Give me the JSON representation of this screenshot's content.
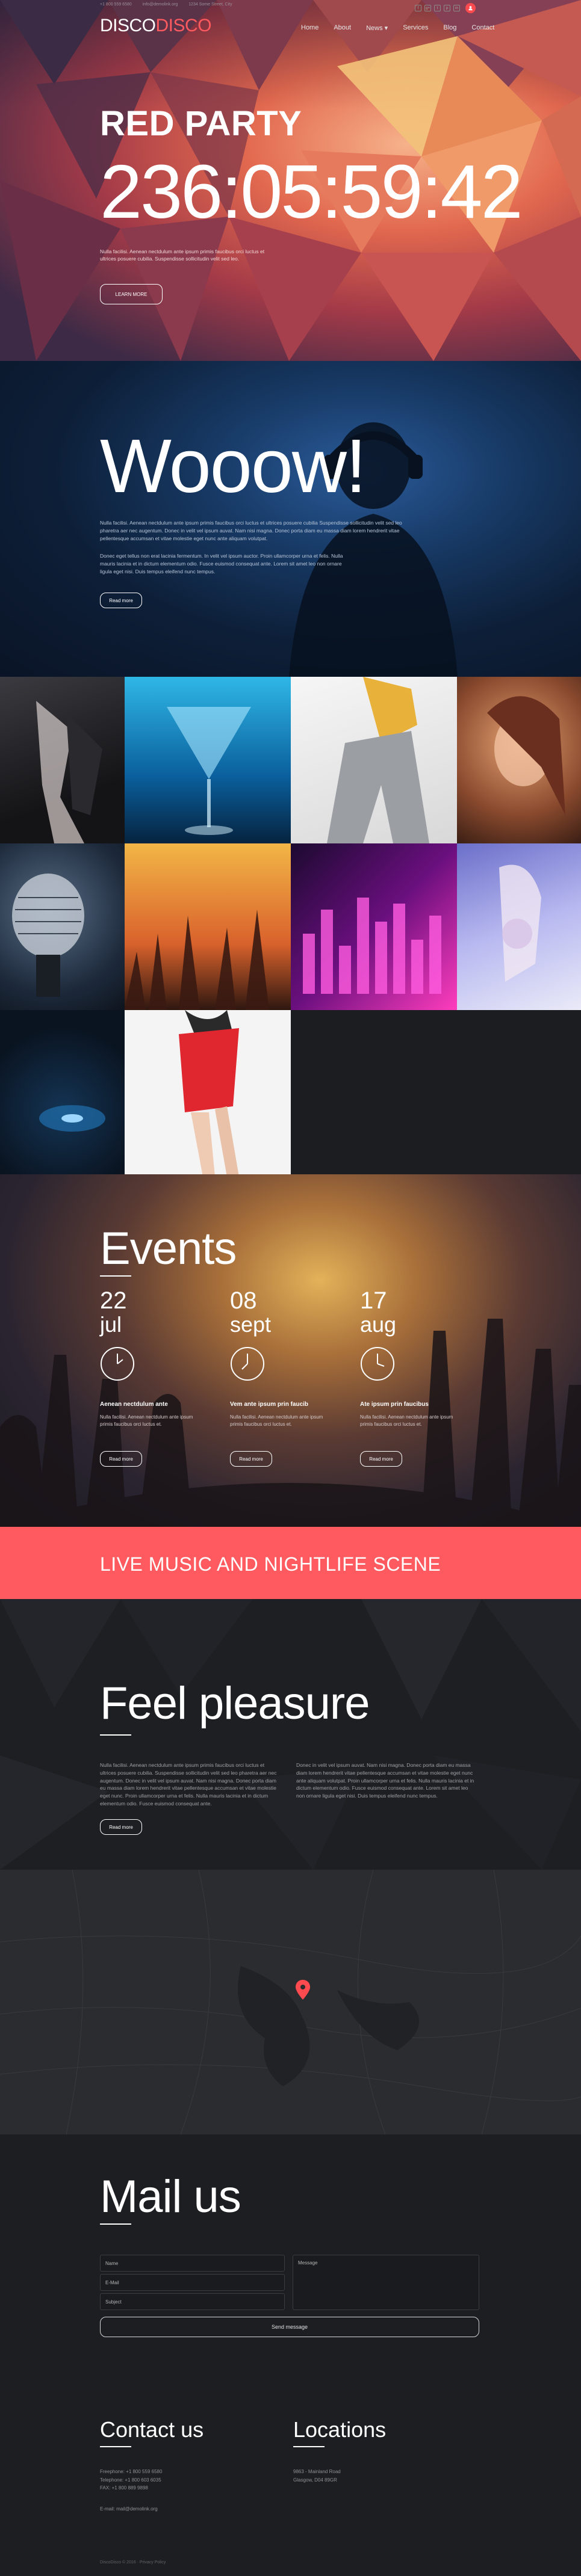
{
  "header": {
    "contacts": [
      "+1 800 559 6580",
      "info@demolink.org",
      "1234 Some Street, City"
    ],
    "logo_part1": "DISCO",
    "logo_part2": "DISCO",
    "socials": [
      "f",
      "g+",
      "t",
      "p",
      "in"
    ],
    "nav": [
      "Home",
      "About",
      "News ▾",
      "Services",
      "Blog",
      "Contact"
    ]
  },
  "hero": {
    "title": "RED PARTY",
    "countdown": "236:05:59:42",
    "text": "Nulla facilisi. Aenean nectdulum ante ipsum primis faucibus orci luctus et ultrices posuere cubilia. Suspendisse sollicitudin velit sed leo.",
    "button": "LEARN MORE"
  },
  "wooow": {
    "title": "Wooow!",
    "p1": "Nulla facilisi. Aenean nectdulum ante ipsum primis faucibus orci luctus et ultrices posuere cubilia Suspendisse sollicitudin velit sed leo pharetra aer nec augentum. Donec in velit vel ipsum auvat. Nam nisi magna. Donec porta diam eu massa diam lorem hendrerit vitae pellentesque accumsan et vitae molestie eget nunc ante aliquam volutpat.",
    "p2": "Donec eget tellus non erat lacinia fermentum. In velit vel ipsum auctor. Proin ullamcorper urna et felis. Nulla mauris lacinia et in dictum elementum odio. Fusce euismod consequat ante. Lorem sit amet leo non ornare ligula eget nisi. Duis tempus eleifend nunc tempus.",
    "button": "Read more"
  },
  "gallery": {
    "tiles": [
      "dancer-legs-photo",
      "cocktail-glass-photo",
      "dancer-jeans-photo",
      "woman-portrait-photo",
      "microphone-photo",
      "crowd-hands-photo",
      "equalizer-lights-photo",
      "singer-glitter-photo",
      "dj-deck-photo",
      "red-dress-photo"
    ]
  },
  "events": {
    "title": "Events",
    "items": [
      {
        "day": "22",
        "month": "jul",
        "name": "Aenean nectdulum ante",
        "desc": "Nulla facilisi. Aenean nectdulum ante ipsum primis faucibus orci luctus et.",
        "button": "Read more"
      },
      {
        "day": "08",
        "month": "sept",
        "name": "Vem ante ipsum prin faucib",
        "desc": "Nulla facilisi. Aenean nectdulum ante ipsum primis faucibus orci luctus et.",
        "button": "Read more"
      },
      {
        "day": "17",
        "month": "aug",
        "name": "Ate ipsum prin faucibus",
        "desc": "Nulla facilisi. Aenean nectdulum ante ipsum primis faucibus orci luctus et.",
        "button": "Read more"
      }
    ]
  },
  "banner": {
    "text": "LIVE MUSIC AND NIGHTLIFE SCENE"
  },
  "feel": {
    "title": "Feel pleasure",
    "col1": "Nulla facilisi. Aenean nectdulum ante ipsum primis faucibus orci luctus et ultrices posuere cubilia. Suspendisse sollicitudin velit sed leo pharetra aer nec augentum. Donec in velit vel ipsum auvat. Nam nisi magna. Donec porta diam eu massa diam lorem hendrerit vitae pellentesque accumsan et vitae molestie eget nunc. Proin ullamcorper urna et felis. Nulla mauris lacinia et in dictum elementum odio. Fusce euismod consequat ante.",
    "col2": "Donec in velit vel ipsum auvat. Nam nisi magna. Donec porta diam eu massa diam lorem hendrerit vitae pellentesque accumsan et vitae molestie eget nunc ante aliquam volutpat. Proin ullamcorper urna et felis. Nulla mauris lacinia et in dictum elementum odio. Fusce euismod consequat ante. Lorem sit amet leo non ornare ligula eget nisi. Duis tempus eleifend nunc tempus.",
    "button": "Read more"
  },
  "map": {
    "marker": "map-pin-icon"
  },
  "mail": {
    "title": "Mail us",
    "name_placeholder": "Name",
    "email_placeholder": "E-Mail",
    "subject_placeholder": "Subject",
    "message_placeholder": "Message",
    "send": "Send message"
  },
  "footer": {
    "contact_title": "Contact us",
    "contact_lines": [
      "Freephone: +1 800 559 6580",
      "Telephone: +1 800 603 6035",
      "FAX: +1 800 889 9898"
    ],
    "email_line": "E-mail: mail@demolink.org",
    "locations_title": "Locations",
    "address_lines": [
      "9863 - Mainland Road",
      "Glasgow, D04 89GR"
    ],
    "copyright": "DiscoDisco © 2016 · Privacy Policy"
  },
  "colors": {
    "accent": "#ff5a5f",
    "background": "#1b1c1e"
  }
}
